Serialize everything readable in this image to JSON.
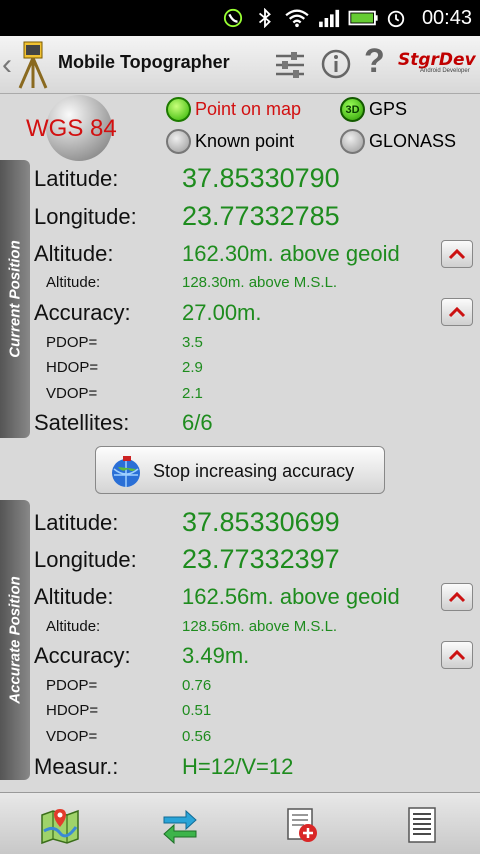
{
  "status_bar": {
    "time": "00:43",
    "icons": [
      "phone-icon",
      "bluetooth-icon",
      "wifi-icon",
      "signal-icon",
      "battery-icon",
      "alarm-icon"
    ]
  },
  "action_bar": {
    "title": "Mobile Topographer",
    "logo": "StgrDev",
    "logo_sub": "Android Developer",
    "icons": [
      "settings-sliders-icon",
      "info-icon",
      "help-icon"
    ]
  },
  "header": {
    "datum": "WGS 84",
    "options": [
      {
        "label": "Point on map",
        "checked": true,
        "color": "#d21010"
      },
      {
        "label": "Known point",
        "checked": false
      },
      {
        "label": "GPS",
        "checked": true,
        "badge": "3D"
      },
      {
        "label": "GLONASS",
        "checked": false
      }
    ]
  },
  "current": {
    "tab_label": "Current Position",
    "latitude_label": "Latitude:",
    "latitude": "37.85330790",
    "longitude_label": "Longitude:",
    "longitude": "23.77332785",
    "altitude_label": "Altitude:",
    "altitude": "162.30m. above geoid",
    "altitude2_label": "Altitude:",
    "altitude2": "128.30m. above M.S.L.",
    "accuracy_label": "Accuracy:",
    "accuracy": "27.00m.",
    "pdop_label": "PDOP=",
    "pdop": "3.5",
    "hdop_label": "HDOP=",
    "hdop": "2.9",
    "vdop_label": "VDOP=",
    "vdop": "2.1",
    "satellites_label": "Satellites:",
    "satellites": "6/6"
  },
  "stop_button": {
    "label": "Stop increasing accuracy"
  },
  "accurate": {
    "tab_label": "Accurate Position",
    "latitude_label": "Latitude:",
    "latitude": "37.85330699",
    "longitude_label": "Longitude:",
    "longitude": "23.77332397",
    "altitude_label": "Altitude:",
    "altitude": "162.56m. above geoid",
    "altitude2_label": "Altitude:",
    "altitude2": "128.56m. above M.S.L.",
    "accuracy_label": "Accuracy:",
    "accuracy": "3.49m.",
    "pdop_label": "PDOP=",
    "pdop": "0.76",
    "hdop_label": "HDOP=",
    "hdop": "0.51",
    "vdop_label": "VDOP=",
    "vdop": "0.56",
    "measur_label": "Measur.:",
    "measur": "H=12/V=12"
  },
  "bottom_bar": {
    "items": [
      "map-icon",
      "swap-arrows-icon",
      "add-document-icon",
      "list-document-icon"
    ]
  },
  "colors": {
    "value_green": "#1e8c1e",
    "accent_red": "#d21010"
  }
}
